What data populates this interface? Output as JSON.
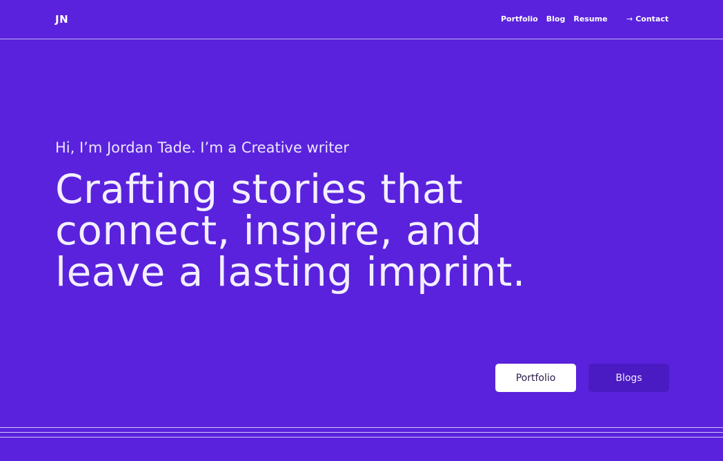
{
  "header": {
    "logo": "JN",
    "nav": [
      "Portfolio",
      "Blog",
      "Resume"
    ],
    "contact_arrow": "→",
    "contact_label": "Contact"
  },
  "hero": {
    "intro": "Hi, I’m Jordan Tade. I’m a Creative writer",
    "headline_lines": [
      "Crafting stories that",
      "connect, inspire, and",
      "leave a lasting imprint."
    ]
  },
  "actions": {
    "portfolio_label": "Portfolio",
    "blogs_label": "Blogs"
  },
  "colors": {
    "background": "#5a22dc",
    "secondary_button": "#4a1bc2",
    "primary_button": "#ffffff"
  }
}
